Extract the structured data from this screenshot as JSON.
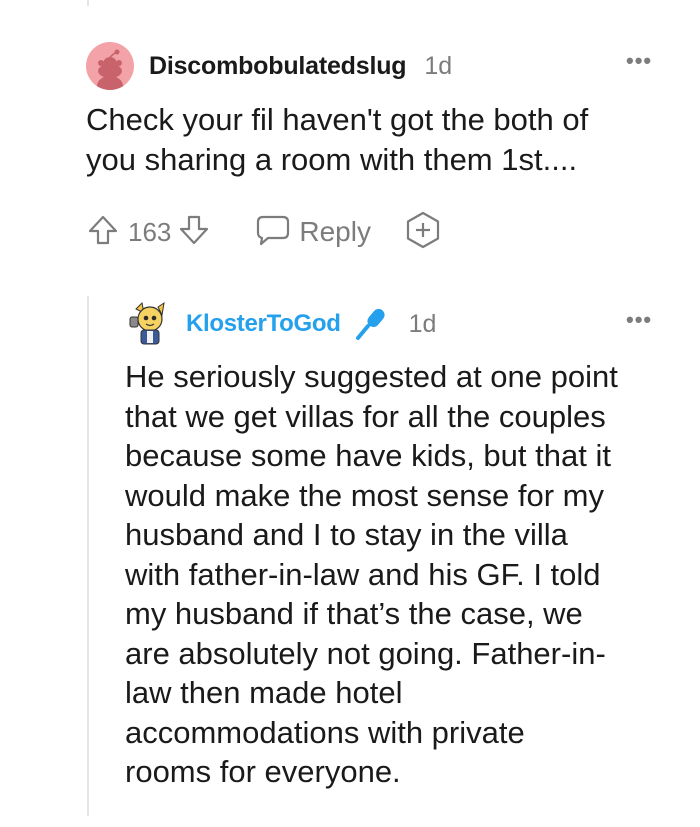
{
  "comments": [
    {
      "username": "Discombobulatedslug",
      "time": "1d",
      "more": "•••",
      "body": "Check your fil haven't got the both of\nyou sharing a room with them 1st....",
      "votes": "163",
      "reply_label": "Reply"
    },
    {
      "username": "KlosterToGod",
      "time": "1d",
      "more": "•••",
      "body": "He seriously suggested at one point\nthat we get villas for all the couples\nbecause some have kids, but that it\nwould make the most sense for my\nhusband and I to stay in the villa\nwith father-in-law and his GF. I told\nmy husband if that’s the case, we\nare absolutely not going. Father-in-\nlaw then made hotel\naccommodations with private\nrooms for everyone."
    }
  ],
  "colors": {
    "username_highlight": "#24a0ed",
    "meta_gray": "#7c7c7c",
    "avatar_bg": "#f3a3a8"
  },
  "icons": [
    "snoo-avatar-icon",
    "upvote-icon",
    "downvote-icon",
    "reply-bubble-icon",
    "award-plus-icon",
    "custom-avatar-icon",
    "microphone-flair-icon"
  ]
}
